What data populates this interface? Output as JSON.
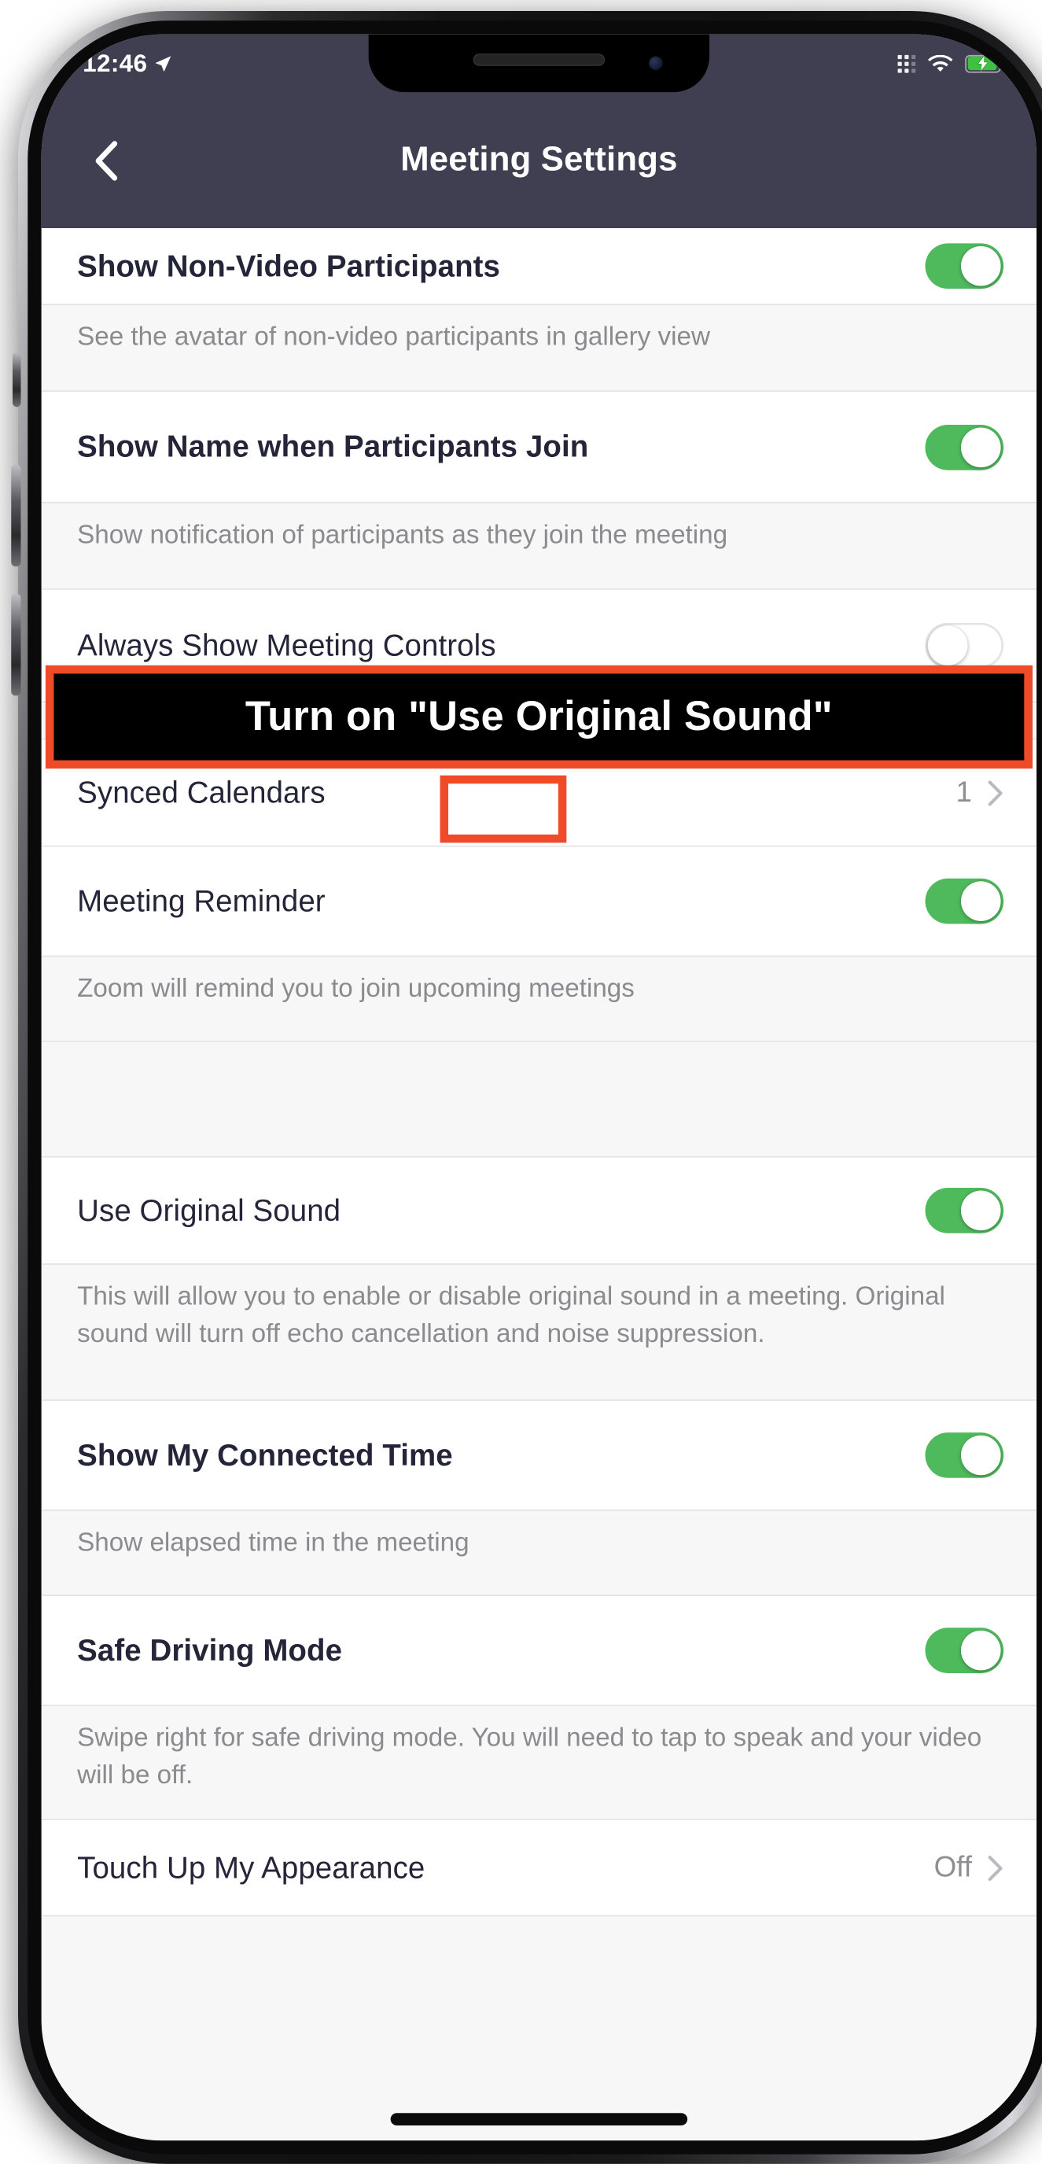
{
  "statusbar": {
    "time": "12:46",
    "location_icon": "location-arrow-icon",
    "cellular_icon": "cellular-dots-icon",
    "wifi_icon": "wifi-icon",
    "battery_icon": "battery-charging-icon"
  },
  "navbar": {
    "back_icon": "chevron-left-icon",
    "title": "Meeting Settings"
  },
  "annotation": {
    "banner_text": "Turn on \"Use Original Sound\"",
    "border_color": "#ef4b28",
    "banner_bg": "#000000",
    "banner_text_color": "#ffffff"
  },
  "colors": {
    "header_bg": "#403f52",
    "toggle_on": "#4fba5c",
    "row_bg": "#ffffff",
    "desc_bg": "#f7f7f8",
    "label_color": "#25253a",
    "muted_color": "#8a8a8f"
  },
  "rows": [
    {
      "id": "show-non-video-participants",
      "label": "Show Non-Video Participants",
      "type": "toggle",
      "state": "on",
      "bold": true,
      "desc": "See the avatar of non-video participants in gallery view"
    },
    {
      "id": "show-name-when-participants-join",
      "label": "Show Name when Participants Join",
      "type": "toggle",
      "state": "on",
      "bold": true,
      "desc": "Show notification of participants as they join the meeting"
    },
    {
      "id": "always-show-meeting-controls",
      "label": "Always Show Meeting Controls",
      "type": "toggle",
      "state": "off",
      "bold": false,
      "desc": null
    },
    {
      "id": "synced-calendars",
      "label": "Synced Calendars",
      "type": "link",
      "value": "1",
      "bold": false,
      "desc": null
    },
    {
      "id": "meeting-reminder",
      "label": "Meeting Reminder",
      "type": "toggle",
      "state": "on",
      "bold": false,
      "desc": "Zoom will remind you to join upcoming meetings"
    },
    {
      "id": "use-original-sound",
      "label": "Use Original Sound",
      "type": "toggle",
      "state": "on",
      "bold": false,
      "desc": "This will allow you to enable or disable original sound in a meeting. Original sound will turn off echo cancellation and noise suppression."
    },
    {
      "id": "show-my-connected-time",
      "label": "Show My Connected Time",
      "type": "toggle",
      "state": "on",
      "bold": true,
      "desc": "Show elapsed time in the meeting"
    },
    {
      "id": "safe-driving-mode",
      "label": "Safe Driving Mode",
      "type": "toggle",
      "state": "on",
      "bold": true,
      "desc": "Swipe right for safe driving mode. You will need to tap to speak and your video will be off."
    },
    {
      "id": "touch-up-my-appearance",
      "label": "Touch Up My Appearance",
      "type": "link",
      "value": "Off",
      "bold": false,
      "desc": null
    }
  ]
}
